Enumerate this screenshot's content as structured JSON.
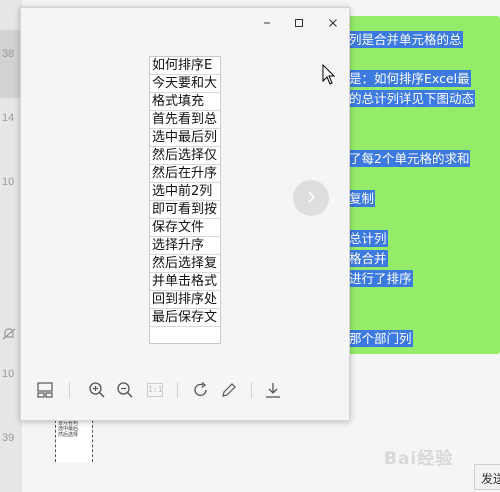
{
  "chat": {
    "timestamps": [
      "38",
      "14",
      "10",
      "10",
      "39"
    ],
    "selected_lines": [
      "列是合并单元格的总",
      "是：如何排序Excel最",
      "的总计列详见下图动态",
      "了每2个单元格的求和",
      "复制",
      "总计列",
      "格合并",
      "进行了排序",
      "那个部门列"
    ],
    "send_label": "发送",
    "watermark": "Bai经验"
  },
  "thumbnail": {
    "lines": [
      "首先看到",
      "选中最后",
      "然后选择"
    ]
  },
  "viewer": {
    "controls": {
      "minimize_icon": "minimize-icon",
      "maximize_icon": "maximize-icon",
      "close_icon": "close-icon"
    },
    "image_rows": [
      "如何排序E",
      "今天要和大",
      "格式填充",
      "首先看到总",
      "选中最后列",
      "然后选择仅",
      "然后在升序",
      "选中前2列",
      "即可看到按",
      "保存文件",
      "选择升序",
      "然后选择复",
      "并单击格式",
      "回到排序处",
      "最后保存文"
    ],
    "toolbar": {
      "thumbnail_icon": "thumbnail-view-icon",
      "zoom_in_icon": "zoom-in-icon",
      "zoom_out_icon": "zoom-out-icon",
      "actual_size_label": "1:1",
      "rotate_icon": "rotate-icon",
      "edit_icon": "edit-icon",
      "download_icon": "download-icon"
    },
    "next_icon": "chevron-right-icon"
  },
  "colors": {
    "bubble": "#95ec69",
    "selection": "#3d7ae0",
    "viewer_bg": "#f5f5f5"
  }
}
